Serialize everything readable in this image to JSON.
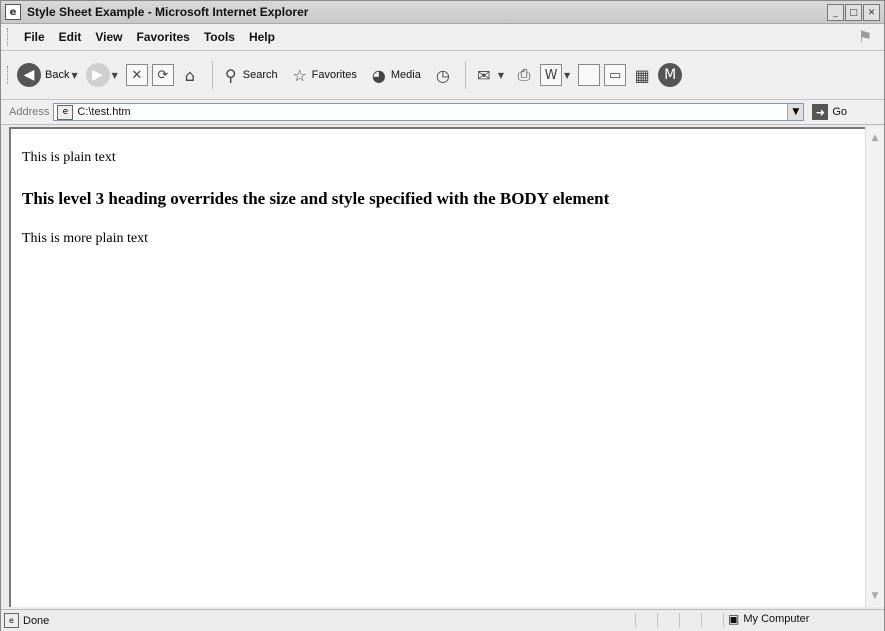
{
  "window": {
    "title": "Style Sheet Example - Microsoft Internet Explorer"
  },
  "menu": [
    "File",
    "Edit",
    "View",
    "Favorites",
    "Tools",
    "Help"
  ],
  "toolbar": {
    "back": "Back",
    "search": "Search",
    "favorites": "Favorites",
    "media": "Media"
  },
  "address": {
    "label": "Address",
    "value": "C:\\test.htm",
    "go": "Go"
  },
  "page": {
    "paragraph1": "This is plain text",
    "heading3": "This level 3 heading overrides the size and style specified with the BODY element",
    "paragraph2": "This is more plain text"
  },
  "status": {
    "text": "Done",
    "zone": "My Computer"
  },
  "icons": [
    "ie-icon",
    "back-icon",
    "forward-icon",
    "stop-icon",
    "refresh-icon",
    "home-icon",
    "search-icon",
    "favorites-icon",
    "media-icon",
    "history-icon",
    "mail-icon",
    "print-icon",
    "edit-icon",
    "discuss-icon",
    "messenger-icon",
    "research-icon",
    "windows-flag-icon",
    "page-icon",
    "go-arrow-icon",
    "computer-icon"
  ]
}
